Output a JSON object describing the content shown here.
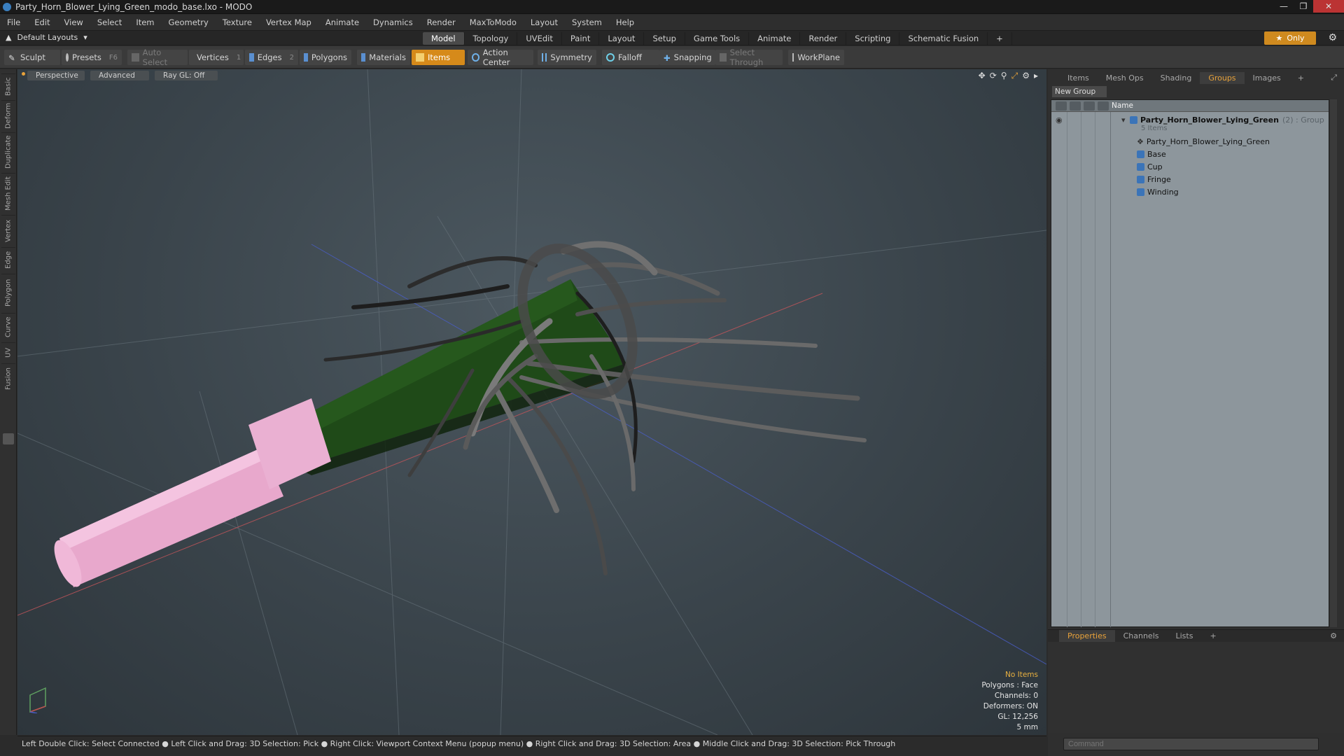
{
  "window": {
    "title": "Party_Horn_Blower_Lying_Green_modo_base.lxo - MODO"
  },
  "menubar": {
    "items": [
      "File",
      "Edit",
      "View",
      "Select",
      "Item",
      "Geometry",
      "Texture",
      "Vertex Map",
      "Animate",
      "Dynamics",
      "Render",
      "MaxToModo",
      "Layout",
      "System",
      "Help"
    ]
  },
  "layoutbar": {
    "layouts_label": "Default Layouts",
    "tabs": [
      "Model",
      "Topology",
      "UVEdit",
      "Paint",
      "Layout",
      "Setup",
      "Game Tools",
      "Animate",
      "Render",
      "Scripting",
      "Schematic Fusion"
    ],
    "active_tab": "Model",
    "only_label": "Only"
  },
  "toolbar": {
    "sculpt": "Sculpt",
    "presets": "Presets",
    "presets_key": "F6",
    "auto_select": "Auto Select",
    "vertices": "Vertices",
    "vertices_count": "1",
    "edges": "Edges",
    "edges_count": "2",
    "polygons": "Polygons",
    "materials": "Materials",
    "items": "Items",
    "action_center": "Action Center",
    "symmetry": "Symmetry",
    "falloff": "Falloff",
    "snapping": "Snapping",
    "select_through": "Select Through",
    "workplane": "WorkPlane"
  },
  "left_tabs": [
    "Basic",
    "Deform",
    "Duplicate",
    "Mesh Edit",
    "Vertex",
    "Edge",
    "Polygon",
    "Curve",
    "UV",
    "Fusion"
  ],
  "viewport": {
    "view_label": "Perspective",
    "advanced_label": "Advanced",
    "raygl_label": "Ray GL: Off",
    "info": {
      "selection": "No Items",
      "polygons": "Polygons : Face",
      "channels": "Channels: 0",
      "deformers": "Deformers: ON",
      "gl": "GL: 12,256",
      "scale": "5 mm"
    }
  },
  "statusbar": {
    "text": "Left Double Click: Select Connected ● Left Click and Drag: 3D Selection: Pick ● Right Click: Viewport Context Menu (popup menu) ● Right Click and Drag: 3D Selection: Area ● Middle Click and Drag: 3D Selection: Pick Through"
  },
  "right_panel": {
    "tabs": [
      "Items",
      "Mesh Ops",
      "Shading",
      "Groups",
      "Images"
    ],
    "active_tab": "Groups",
    "new_group": "New Group",
    "column_name": "Name",
    "group": {
      "name": "Party_Horn_Blower_Lying_Green",
      "suffix": "(2) : Group",
      "count": "5 Items",
      "children": [
        "Party_Horn_Blower_Lying_Green",
        "Base",
        "Cup",
        "Fringe",
        "Winding"
      ]
    },
    "bottom_tabs": [
      "Properties",
      "Channels",
      "Lists"
    ],
    "bottom_active": "Properties",
    "command_placeholder": "Command"
  },
  "colors": {
    "accent": "#d68a1a",
    "viewport_bg": "#3a444b",
    "horn_green": "#1f4a18",
    "mouthpiece_pink": "#e8a8cc",
    "fringe_grey": "#6a6a6a"
  }
}
